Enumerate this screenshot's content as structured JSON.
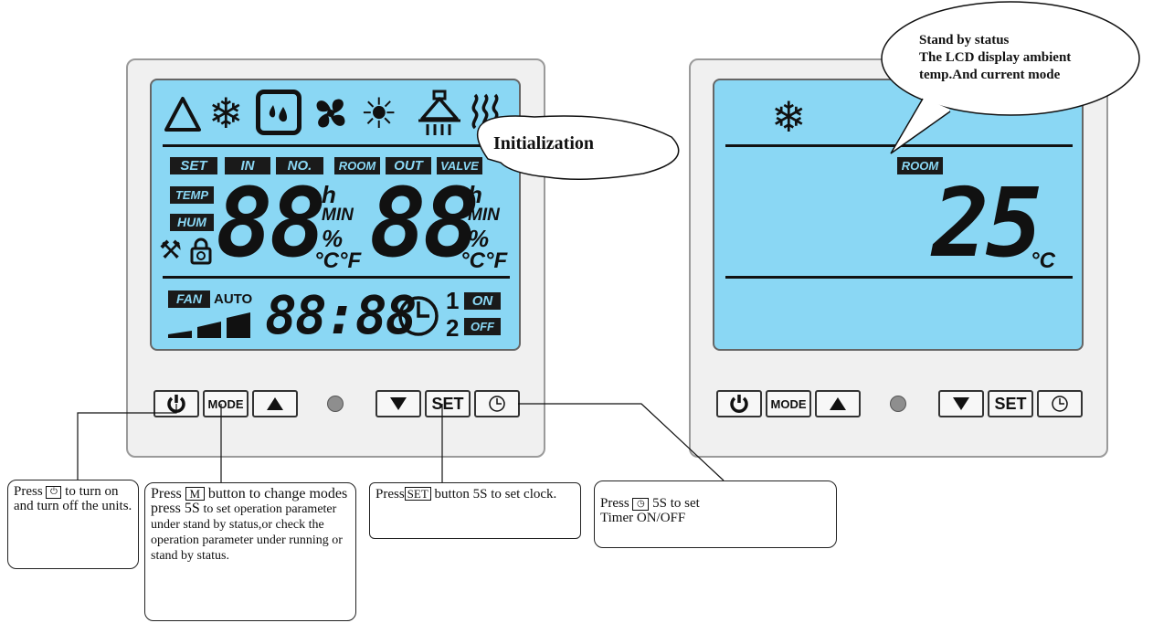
{
  "left_panel": {
    "mode_icons": [
      "triangle-mode-icon",
      "snowflake-icon",
      "dry-drop-icon",
      "fan-icon",
      "sun-icon",
      "shower-icon",
      "heater-icon"
    ],
    "tags": {
      "set": "SET",
      "in": "IN",
      "no": "NO.",
      "room": "ROOM",
      "out": "OUT",
      "valve": "VALVE",
      "temp": "TEMP",
      "hum": "HUM",
      "fan": "FAN",
      "on": "ON",
      "off": "OFF"
    },
    "auto_label": "AUTO",
    "digits_left": "88",
    "digits_right": "88",
    "clock_digits": "88:88",
    "unit_h": "h",
    "unit_min": "MIN",
    "unit_pct": "%",
    "unit_cf": "°C°F",
    "timer_1": "1",
    "timer_2": "2"
  },
  "right_panel": {
    "room_tag": "ROOM",
    "temp_value": "25",
    "temp_unit": "°C"
  },
  "buttons": {
    "mode": "MODE",
    "set": "SET"
  },
  "callouts": {
    "initialization": "Initialization",
    "standby_line1": "Stand by status",
    "standby_line2": "The LCD display ambient",
    "standby_line3": "temp.And current mode"
  },
  "notes": {
    "power_a": "Press",
    "power_b": "to turn on and turn off the units.",
    "mode_a": "Press",
    "mode_key": "M",
    "mode_b": "button to change modes press 5S",
    "mode_c": "to set operation parameter under stand by status,or check the operation parameter under running or stand by status.",
    "set_a": "Press",
    "set_key": "SET",
    "set_b": "button 5S to set clock.",
    "timer_a": "Press",
    "timer_b": "5S to set",
    "timer_c": "Timer ON/OFF"
  }
}
